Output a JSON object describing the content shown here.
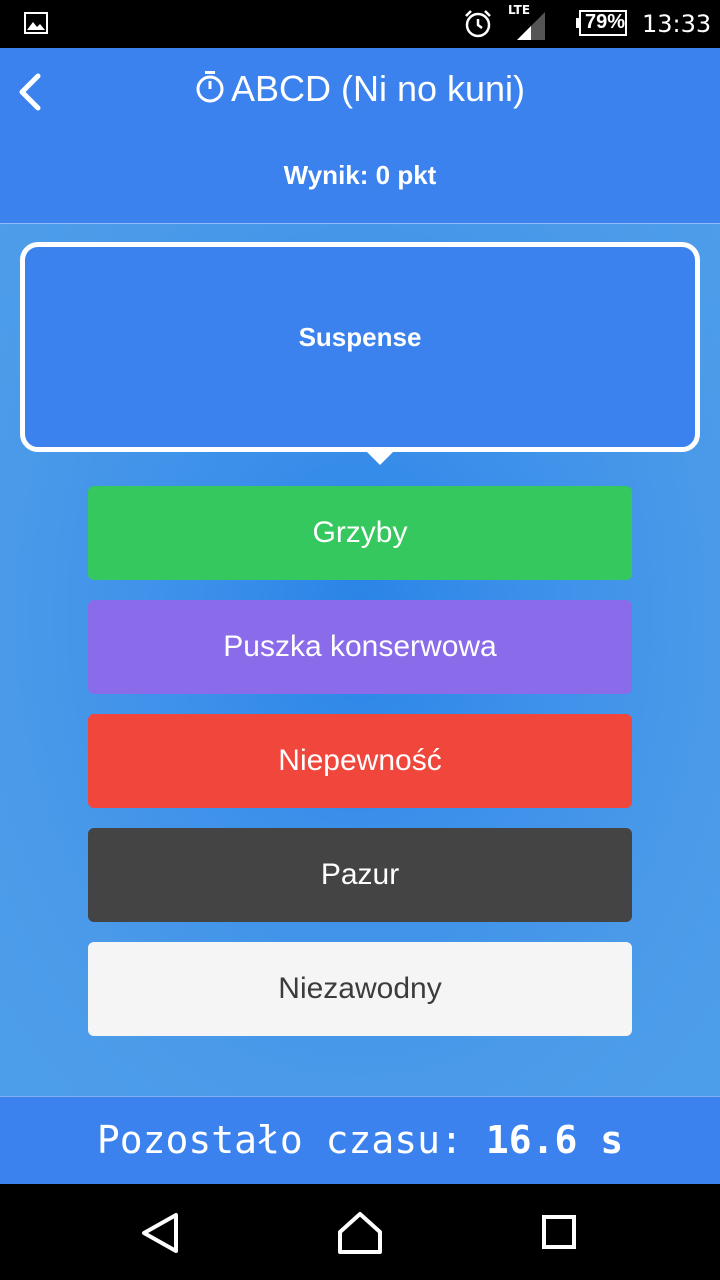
{
  "status_bar": {
    "network": "LTE",
    "battery": "79%",
    "time": "13:33",
    "icons": [
      "gallery-icon",
      "alarm-icon",
      "signal-icon",
      "battery-icon"
    ]
  },
  "header": {
    "title": "ABCD (Ni no kuni)",
    "score": "Wynik: 0 pkt",
    "icons": [
      "back-icon",
      "timer-icon"
    ]
  },
  "question": {
    "text": "Suspense"
  },
  "answers": [
    {
      "label": "Grzyby",
      "color": "#34c85e"
    },
    {
      "label": "Puszka konserwowa",
      "color": "#8a6be9"
    },
    {
      "label": "Niepewność",
      "color": "#f0463c"
    },
    {
      "label": "Pazur",
      "color": "#444444"
    },
    {
      "label": "Niezawodny",
      "color": "#f5f5f5"
    }
  ],
  "timer": {
    "label": "Pozostało czasu: ",
    "value": "16.6 s"
  },
  "nav": {
    "icons": [
      "nav-back-icon",
      "home-icon",
      "recent-apps-icon"
    ]
  },
  "colors": {
    "primary": "#3b82ef",
    "background": "#4a9ae9"
  }
}
